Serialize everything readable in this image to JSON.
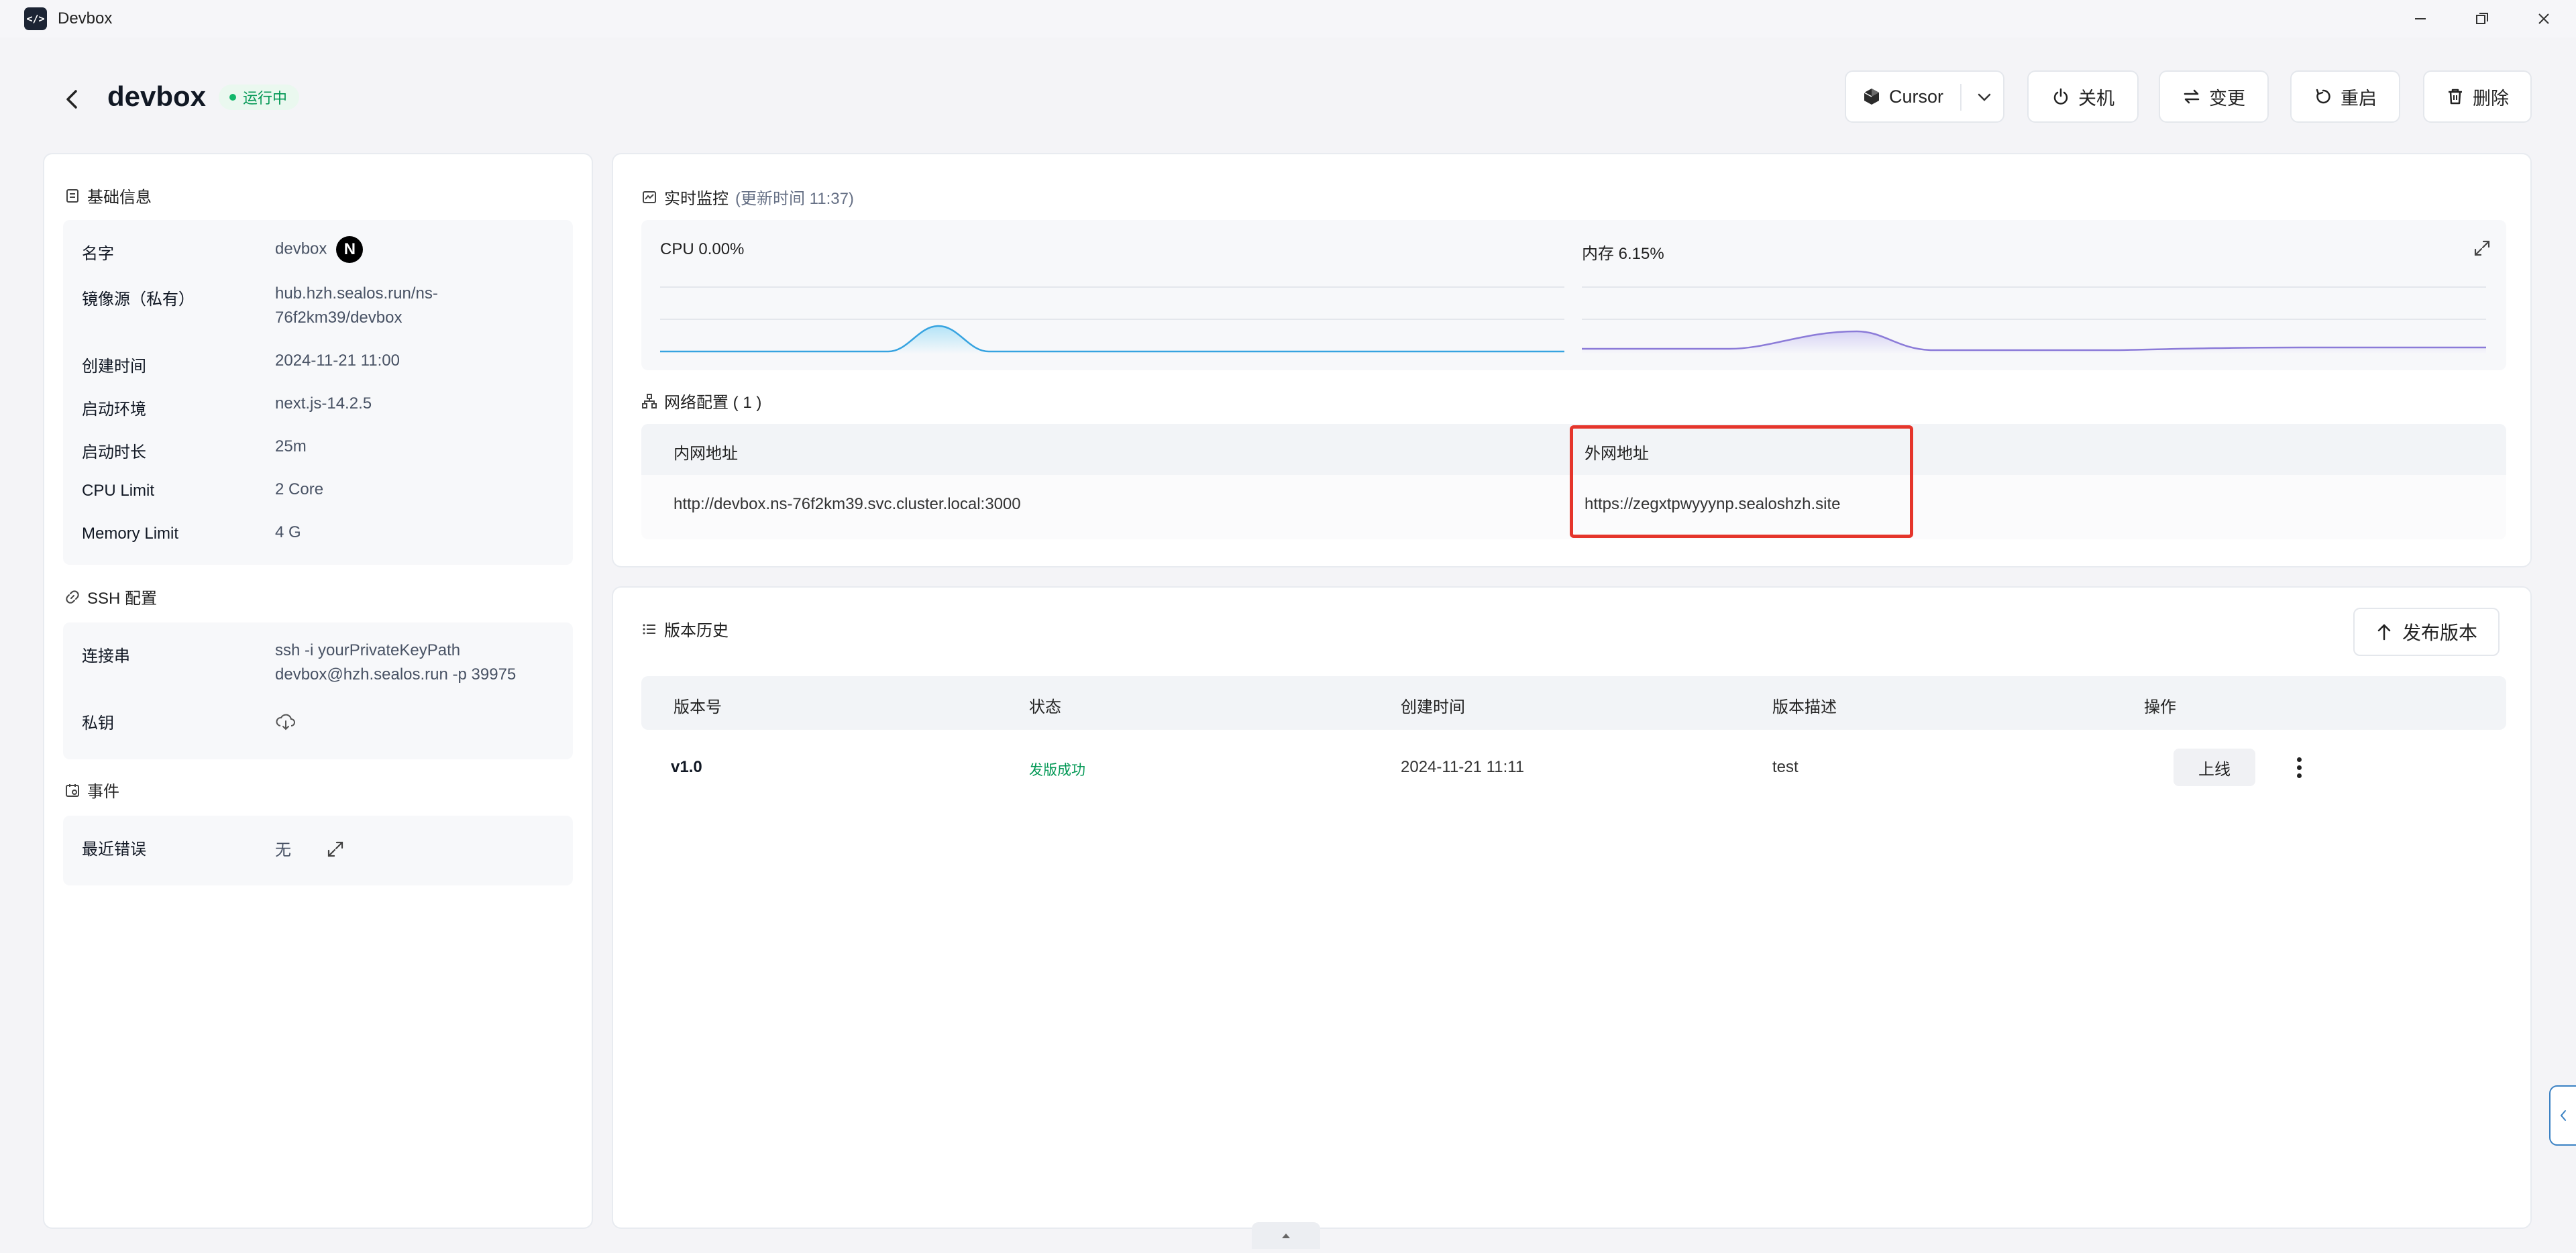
{
  "window": {
    "title": "Devbox"
  },
  "header": {
    "title": "devbox",
    "status": "运行中",
    "ide": "Cursor",
    "actions": {
      "shutdown": "关机",
      "change": "变更",
      "restart": "重启",
      "delete": "删除"
    }
  },
  "basic_info": {
    "title": "基础信息",
    "rows": [
      {
        "label": "名字",
        "value": "devbox"
      },
      {
        "label": "镜像源（私有）",
        "value_line1": "hub.hzh.sealos.run/ns-",
        "value_line2": "76f2km39/devbox"
      },
      {
        "label": "创建时间",
        "value": "2024-11-21 11:00"
      },
      {
        "label": "启动环境",
        "value": "next.js-14.2.5"
      },
      {
        "label": "启动时长",
        "value": "25m"
      },
      {
        "label": "CPU Limit",
        "value": "2 Core"
      },
      {
        "label": "Memory Limit",
        "value": "4 G"
      }
    ]
  },
  "ssh": {
    "title": "SSH 配置",
    "conn_label": "连接串",
    "conn_line1": "ssh -i yourPrivateKeyPath",
    "conn_line2": "devbox@hzh.sealos.run -p 39975",
    "key_label": "私钥"
  },
  "events": {
    "title": "事件",
    "recent_error_label": "最近错误",
    "recent_error_value": "无"
  },
  "monitor": {
    "title": "实时监控",
    "updated": "(更新时间  11:37)",
    "cpu_label": "CPU 0.00%",
    "mem_label": "内存 6.15%"
  },
  "network": {
    "title": "网络配置 ( 1 )",
    "col_internal": "内网地址",
    "col_external": "外网地址",
    "internal": "http://devbox.ns-76f2km39.svc.cluster.local:3000",
    "external": "https://zegxtpwyyynp.sealoshzh.site"
  },
  "versions": {
    "title": "版本历史",
    "publish": "发布版本",
    "columns": [
      "版本号",
      "状态",
      "创建时间",
      "版本描述",
      "操作"
    ],
    "rows": [
      {
        "version": "v1.0",
        "status": "发版成功",
        "created": "2024-11-21 11:11",
        "desc": "test",
        "action": "上线"
      }
    ]
  },
  "colors": {
    "cpu": "#36a3e0",
    "memory": "#8b7bd8",
    "success": "#039855",
    "highlight": "#e5352b"
  }
}
